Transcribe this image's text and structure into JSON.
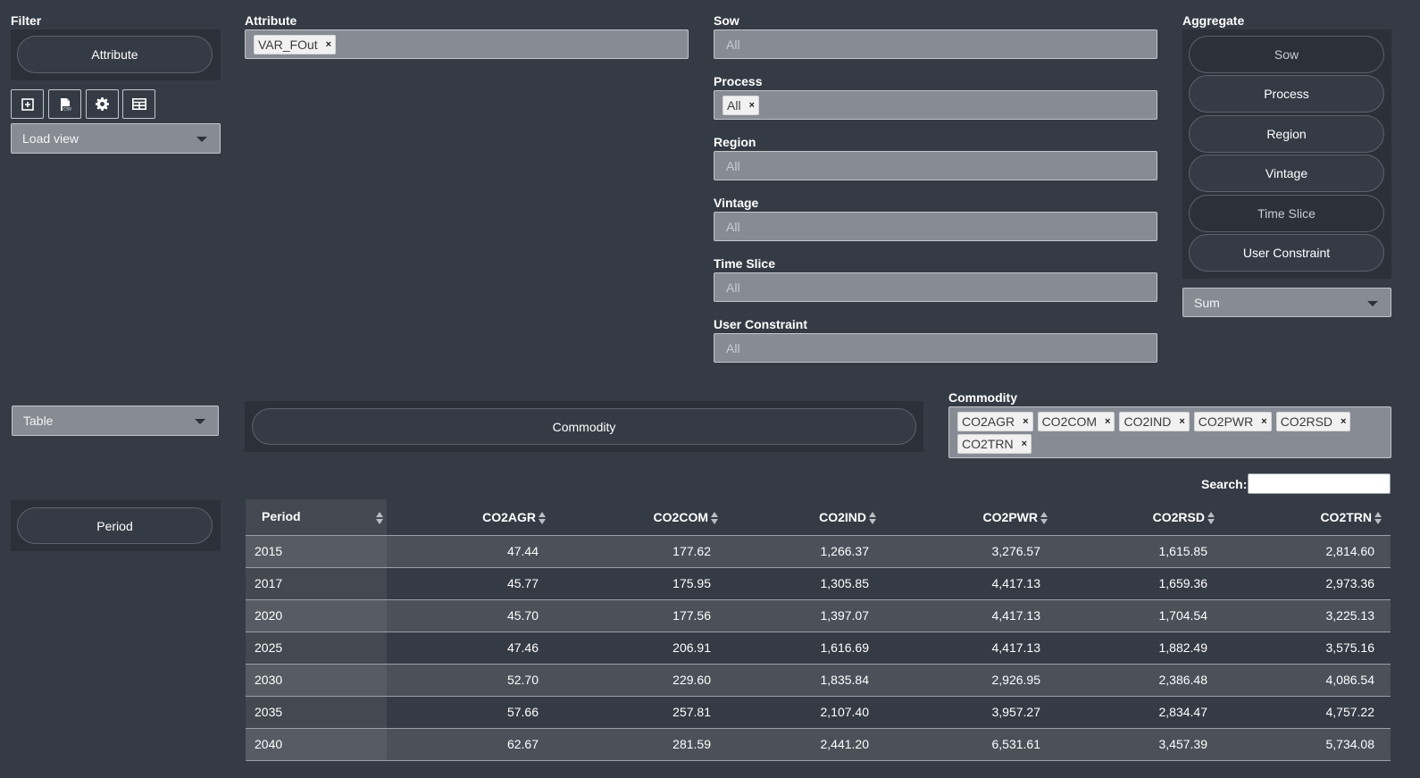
{
  "filter": {
    "label": "Filter",
    "attribute_button": "Attribute",
    "load_view": "Load view"
  },
  "attribute": {
    "label": "Attribute",
    "tags": [
      "VAR_FOut"
    ]
  },
  "filters": {
    "sow": {
      "label": "Sow",
      "placeholder": "All"
    },
    "process": {
      "label": "Process",
      "tags": [
        "All"
      ]
    },
    "region": {
      "label": "Region",
      "placeholder": "All"
    },
    "vintage": {
      "label": "Vintage",
      "placeholder": "All"
    },
    "time_slice": {
      "label": "Time Slice",
      "placeholder": "All"
    },
    "user_constraint": {
      "label": "User Constraint",
      "placeholder": "All"
    }
  },
  "aggregate": {
    "label": "Aggregate",
    "items": [
      "Sow",
      "Process",
      "Region",
      "Vintage",
      "Time Slice",
      "User Constraint"
    ],
    "function": "Sum"
  },
  "view_type": "Table",
  "columns_pivot": "Commodity",
  "rows_pivot": "Period",
  "commodity": {
    "label": "Commodity",
    "tags": [
      "CO2AGR",
      "CO2COM",
      "CO2IND",
      "CO2PWR",
      "CO2RSD",
      "CO2TRN"
    ]
  },
  "search": {
    "label": "Search:",
    "value": ""
  },
  "table": {
    "headers": [
      "Period",
      "CO2AGR",
      "CO2COM",
      "CO2IND",
      "CO2PWR",
      "CO2RSD",
      "CO2TRN"
    ],
    "rows": [
      [
        "2015",
        "47.44",
        "177.62",
        "1,266.37",
        "3,276.57",
        "1,615.85",
        "2,814.60"
      ],
      [
        "2017",
        "45.77",
        "175.95",
        "1,305.85",
        "4,417.13",
        "1,659.36",
        "2,973.36"
      ],
      [
        "2020",
        "45.70",
        "177.56",
        "1,397.07",
        "4,417.13",
        "1,704.54",
        "3,225.13"
      ],
      [
        "2025",
        "47.46",
        "206.91",
        "1,616.69",
        "4,417.13",
        "1,882.49",
        "3,575.16"
      ],
      [
        "2030",
        "52.70",
        "229.60",
        "1,835.84",
        "2,926.95",
        "2,386.48",
        "4,086.54"
      ],
      [
        "2035",
        "57.66",
        "257.81",
        "2,107.40",
        "3,957.27",
        "2,834.47",
        "4,757.22"
      ],
      [
        "2040",
        "62.67",
        "281.59",
        "2,441.20",
        "6,531.61",
        "3,457.39",
        "5,734.08"
      ]
    ]
  },
  "icons": [
    "add-view-icon",
    "csv-export-icon",
    "gear-icon",
    "table-icon"
  ]
}
